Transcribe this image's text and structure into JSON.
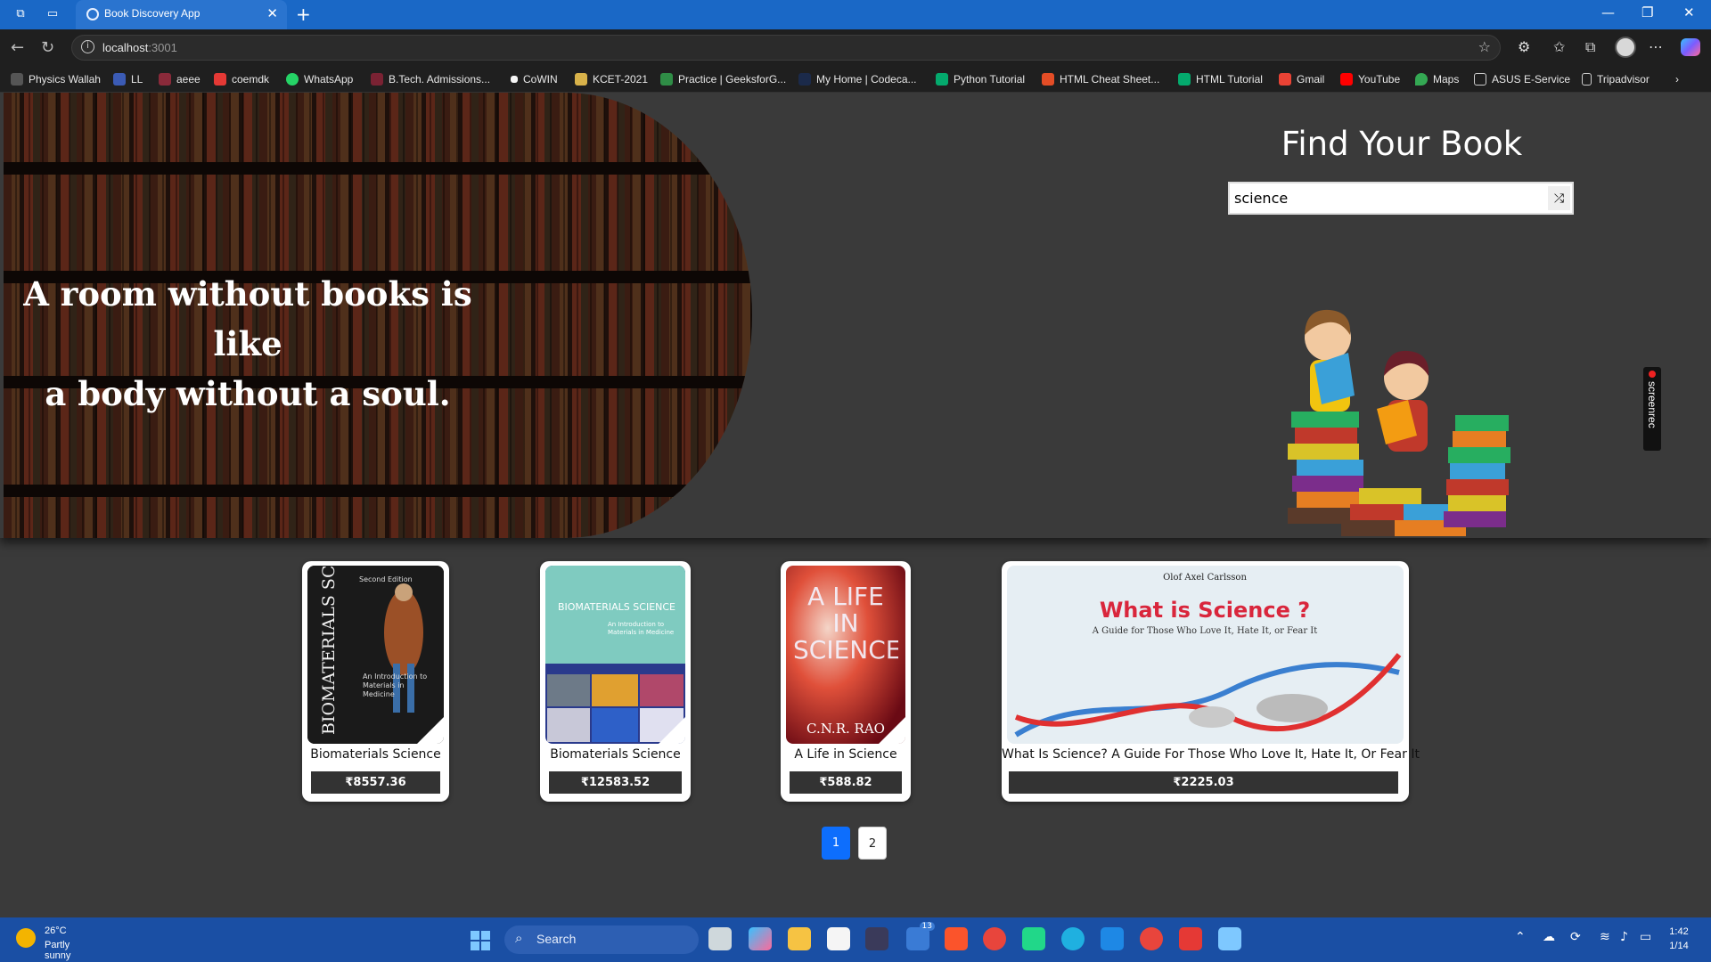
{
  "browser": {
    "tab_title": "Book Discovery App",
    "url_host": "localhost",
    "url_port": ":3001"
  },
  "bookmarks": [
    {
      "label": "Physics Wallah",
      "color": "#555555"
    },
    {
      "label": "LL",
      "color": "#3b5bb5"
    },
    {
      "label": "aeee",
      "color": "#8a2a3a"
    },
    {
      "label": "coemdk",
      "color": "#e53935"
    },
    {
      "label": "WhatsApp",
      "color": "#25d366"
    },
    {
      "label": "B.Tech. Admissions...",
      "color": "#7a2233"
    },
    {
      "label": "CoWIN",
      "color": "#f5f5f5"
    },
    {
      "label": "KCET-2021",
      "color": "#d8b24a"
    },
    {
      "label": "Practice | GeeksforG...",
      "color": "#2f8d46"
    },
    {
      "label": "My Home | Codeca...",
      "color": "#1b2a4a"
    },
    {
      "label": "Python Tutorial",
      "color": "#04aa6d"
    },
    {
      "label": "HTML Cheat Sheet...",
      "color": "#e44d26"
    },
    {
      "label": "HTML Tutorial",
      "color": "#04aa6d"
    },
    {
      "label": "Gmail",
      "color": "#ea4335"
    },
    {
      "label": "YouTube",
      "color": "#ff0000"
    },
    {
      "label": "Maps",
      "color": "#34a853"
    },
    {
      "label": "ASUS E-Service",
      "color": "#cccccc"
    },
    {
      "label": "Tripadvisor",
      "color": "#cccccc"
    }
  ],
  "hero": {
    "quote_line1": "A room without books is like",
    "quote_line2": "a body without a soul."
  },
  "search": {
    "title": "Find Your Book",
    "value": "science",
    "button_icon": "shuffle-icon"
  },
  "books": [
    {
      "title": "Biomaterials Science",
      "price": "₹8557.36",
      "cover_color": "#111111"
    },
    {
      "title": "Biomaterials Science",
      "price": "₹12583.52",
      "cover_color": "#2a3a8c"
    },
    {
      "title": "A Life in Science",
      "price": "₹588.82",
      "cover_color": "#c0392b"
    },
    {
      "title": "What Is Science? A Guide For Those Who Love It, Hate It, Or Fear It",
      "price": "₹2225.03",
      "cover_color": "#dfe7ee"
    }
  ],
  "book_covers": {
    "cover1_text": "BIOMATERIALS SCIENCE",
    "cover1_sub": "An Introduction to Materials in Medicine",
    "cover1_edition": "Second Edition",
    "cover2_title": "BIOMATERIALS SCIENCE",
    "cover2_sub": "An Introduction to Materials in Medicine",
    "cover3_text": "A LIFE IN SCIENCE",
    "cover3_author": "C.N.R. RAO",
    "cover4_title": "What is Science ?",
    "cover4_sub": "A Guide for Those Who Love It, Hate It, or Fear It",
    "cover4_author": "Olof Axel Carlsson"
  },
  "pagination": {
    "pages": [
      "1",
      "2"
    ],
    "active": "1"
  },
  "recorder_label": "screenrec",
  "taskbar": {
    "temp": "26°C",
    "weather": "Partly sunny",
    "search_label": "Search",
    "time": "1:42",
    "date": "1/14",
    "badge": "13"
  },
  "colors": {
    "accent": "#0d6efd",
    "page_bg": "#3a3a3a",
    "price_bg": "#333333"
  }
}
